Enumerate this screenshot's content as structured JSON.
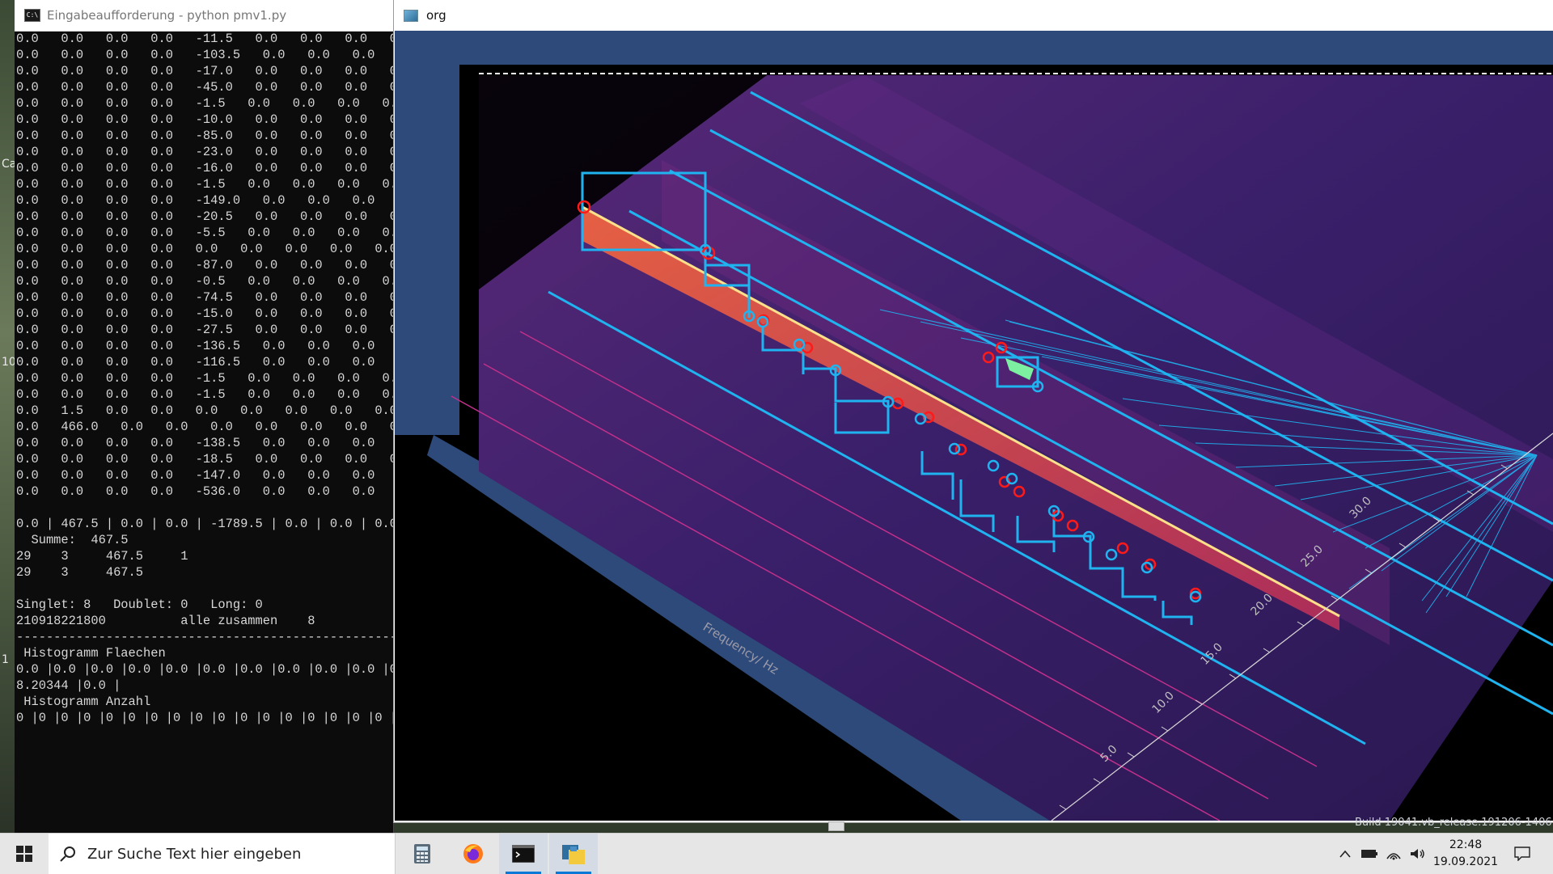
{
  "console": {
    "title": "Eingabeaufforderung - python  pmv1.py",
    "lines": [
      "0.0   0.0   0.0   0.0   -11.5   0.0   0.0   0.0   0.0   0.",
      "0.0   0.0   0.0   0.0   -103.5   0.0   0.0   0.0   0.0   0.",
      "0.0   0.0   0.0   0.0   -17.0   0.0   0.0   0.0   0.0   0.",
      "0.0   0.0   0.0   0.0   -45.0   0.0   0.0   0.0   0.0   0.",
      "0.0   0.0   0.0   0.0   -1.5   0.0   0.0   0.0   0.0   0.",
      "0.0   0.0   0.0   0.0   -10.0   0.0   0.0   0.0   0.0   0.",
      "0.0   0.0   0.0   0.0   -85.0   0.0   0.0   0.0   0.0   0.",
      "0.0   0.0   0.0   0.0   -23.0   0.0   0.0   0.0   0.0   0.",
      "0.0   0.0   0.0   0.0   -16.0   0.0   0.0   0.0   0.0   0.",
      "0.0   0.0   0.0   0.0   -1.5   0.0   0.0   0.0   0.0   0.",
      "0.0   0.0   0.0   0.0   -149.0   0.0   0.0   0.0   0.0   0",
      "0.0   0.0   0.0   0.0   -20.5   0.0   0.0   0.0   0.0   0.",
      "0.0   0.0   0.0   0.0   -5.5   0.0   0.0   0.0   0.0   0.0",
      "0.0   0.0   0.0   0.0   0.0   0.0   0.0   0.0   0.0   0.0",
      "0.0   0.0   0.0   0.0   -87.0   0.0   0.0   0.0   0.0   0.",
      "0.0   0.0   0.0   0.0   -0.5   0.0   0.0   0.0   0.0   0.0",
      "0.0   0.0   0.0   0.0   -74.5   0.0   0.0   0.0   0.0   0.",
      "0.0   0.0   0.0   0.0   -15.0   0.0   0.0   0.0   0.0   0.",
      "0.0   0.0   0.0   0.0   -27.5   0.0   0.0   0.0   0.0   0.",
      "0.0   0.0   0.0   0.0   -136.5   0.0   0.0   0.0   0.0   0",
      "0.0   0.0   0.0   0.0   -116.5   0.0   0.0   0.0   0.0   0",
      "0.0   0.0   0.0   0.0   -1.5   0.0   0.0   0.0   0.0   0.",
      "0.0   0.0   0.0   0.0   -1.5   0.0   0.0   0.0   0.0   0.",
      "0.0   1.5   0.0   0.0   0.0   0.0   0.0   0.0   0.0   0.",
      "0.0   466.0   0.0   0.0   0.0   0.0   0.0   0.0   0.0   0",
      "0.0   0.0   0.0   0.0   -138.5   0.0   0.0   0.0   0.0   0",
      "0.0   0.0   0.0   0.0   -18.5   0.0   0.0   0.0   0.0   0.",
      "0.0   0.0   0.0   0.0   -147.0   0.0   0.0   0.0   0.0   0",
      "0.0   0.0   0.0   0.0   -536.0   0.0   0.0   0.0   0.0   0",
      "",
      "0.0 | 467.5 | 0.0 | 0.0 | -1789.5 | 0.0 | 0.0 | 0.0",
      "  Summe:  467.5",
      "29    3     467.5     1",
      "29    3     467.5",
      "",
      "Singlet: 8   Doublet: 0   Long: 0",
      "210918221800          alle zusammen    8",
      "-----------------------------------------------------",
      " Histogramm Flaechen",
      "0.0 |0.0 |0.0 |0.0 |0.0 |0.0 |0.0 |0.0 |0.0 |0.0 |0.0 |0.",
      "8.20344 |0.0 |",
      " Histogramm Anzahl",
      "0 |0 |0 |0 |0 |0 |0 |0 |0 |0 |0 |0 |0 |0 |0 |0 |0 |0 |0"
    ]
  },
  "desktop": {
    "glyph_ca": "Ca",
    "glyph_10": "10",
    "glyph_1": "1"
  },
  "plot_window": {
    "title": "org",
    "axis_label": "Frequency/ Hz",
    "ticks": [
      "5.0",
      "10.0",
      "15.0",
      "20.0",
      "25.0",
      "30.0"
    ]
  },
  "build_text": "Build 19041.vb_release.191206-1406",
  "taskbar": {
    "search_placeholder": "Zur Suche Text hier eingeben",
    "apps": [
      "calculator-icon",
      "firefox-icon",
      "console-icon",
      "python-icon"
    ],
    "time": "22:48",
    "date": "19.09.2021"
  },
  "colors": {
    "cyan": "#1fb4f0",
    "red_marker": "#ff1a1a",
    "floor": "#2e4a7a",
    "background": "#000000"
  }
}
